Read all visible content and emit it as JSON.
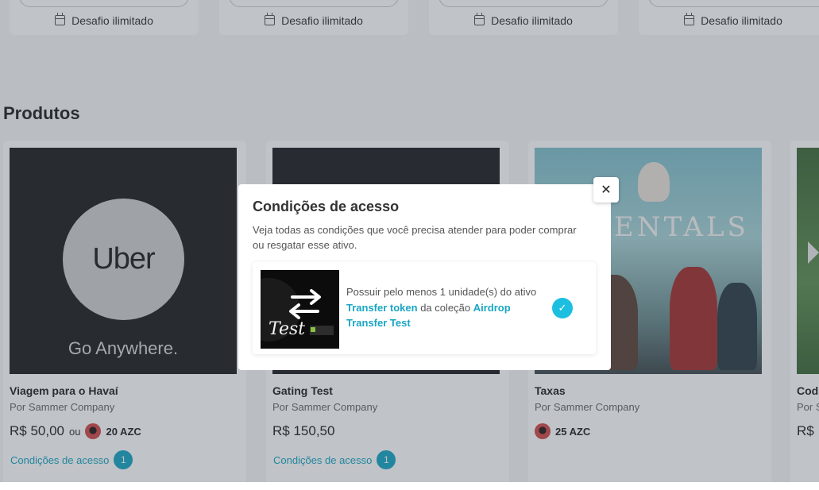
{
  "challenges": {
    "label": "Desafio ilimitado",
    "icon": "calendar-icon"
  },
  "section": {
    "title": "Produtos"
  },
  "products": [
    {
      "name": "Viagem para o Havaí",
      "by": "Por Sammer Company",
      "price": "R$ 50,00",
      "or": "ou",
      "azc": "20 AZC",
      "conditions_label": "Condições de acesso",
      "conditions_count": "1",
      "thumb": {
        "brand": "Uber",
        "tagline": "Go Anywhere."
      }
    },
    {
      "name": "Gating Test",
      "by": "Por Sammer Company",
      "price": "R$ 150,50",
      "conditions_label": "Condições de acesso",
      "conditions_count": "1"
    },
    {
      "name": "Taxas",
      "by": "Por Sammer Company",
      "azc": "25 AZC",
      "thumb": {
        "word": "ENTALS"
      }
    },
    {
      "name": "Cod",
      "by": "Por S",
      "price": "R$"
    }
  ],
  "modal": {
    "title": "Condições de acesso",
    "description": "Veja todas as condições que você precisa atender para poder comprar ou resgatar esse ativo.",
    "condition": {
      "prefix": "Possuir pelo menos 1 unidade(s) do ativo ",
      "token": "Transfer token",
      "middle": " da coleção ",
      "collection": "Airdrop Transfer Test",
      "thumb_label": "Test"
    },
    "close_symbol": "✕",
    "check_symbol": "✓"
  },
  "colors": {
    "accent": "#19a6c4",
    "check": "#1dbfe0",
    "overlay": "rgba(60,68,80,0.32)"
  }
}
